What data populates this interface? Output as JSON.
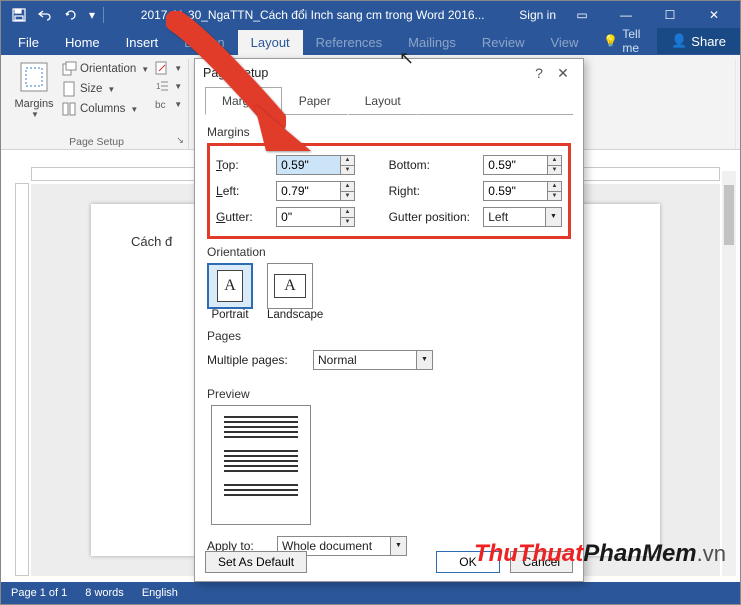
{
  "titlebar": {
    "doc_title": "2017-11-30_NgaTTN_Cách đổi Inch sang cm trong Word 2016...",
    "sign_in": "Sign in"
  },
  "tabs": {
    "file": "File",
    "home": "Home",
    "insert": "Insert",
    "design": "Design",
    "layout": "Layout",
    "references": "References",
    "mailings": "Mailings",
    "review": "Review",
    "view": "View",
    "tellme": "Tell me",
    "share": "Share"
  },
  "ribbon": {
    "margins": "Margins",
    "orientation": "Orientation",
    "size": "Size",
    "columns": "Columns",
    "page_setup_group": "Page Setup"
  },
  "doc_preview_text": "Cách đ",
  "dialog": {
    "title": "Page Setup",
    "tab_margins": "Margins",
    "tab_paper": "Paper",
    "tab_layout": "Layout",
    "section_margins": "Margins",
    "top_label": "Top:",
    "top_value": "0.59\"",
    "bottom_label": "Bottom:",
    "bottom_value": "0.59\"",
    "left_label": "Left:",
    "left_value": "0.79\"",
    "right_label": "Right:",
    "right_value": "0.59\"",
    "gutter_label": "Gutter:",
    "gutter_value": "0\"",
    "gutter_pos_label": "Gutter position:",
    "gutter_pos_value": "Left",
    "section_orientation": "Orientation",
    "portrait": "Portrait",
    "landscape": "Landscape",
    "section_pages": "Pages",
    "multiple_pages": "Multiple pages:",
    "multiple_pages_value": "Normal",
    "section_preview": "Preview",
    "apply_to": "Apply to:",
    "apply_to_value": "Whole document",
    "set_default": "Set As Default",
    "ok": "OK",
    "cancel": "Cancel"
  },
  "status": {
    "page": "Page 1 of 1",
    "words": "8 words",
    "lang": "English"
  },
  "watermark": {
    "a": "ThuThuat",
    "b": "PhanMem",
    "c": ".vn"
  }
}
